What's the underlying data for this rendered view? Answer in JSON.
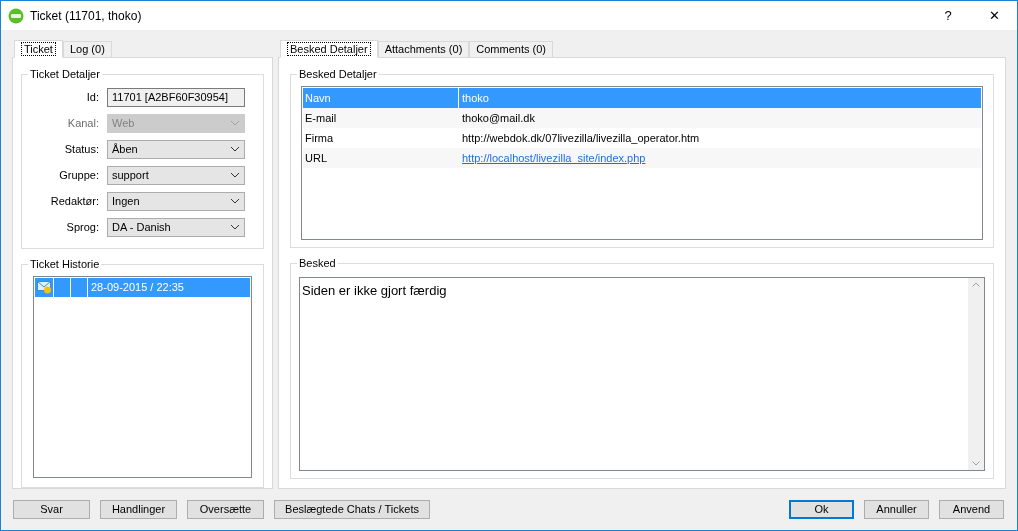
{
  "window": {
    "title": "Ticket (11701, thoko)",
    "controls": [
      "?",
      "✕"
    ]
  },
  "left_tabs": [
    {
      "label": "Ticket",
      "selected": true
    },
    {
      "label": "Log (0)",
      "selected": false
    }
  ],
  "ticket_details": {
    "title": "Ticket Detaljer",
    "fields": [
      {
        "label": "Id:",
        "kind": "text",
        "value": "11701 [A2BF60F30954]",
        "disabled": false
      },
      {
        "label": "Kanal:",
        "kind": "select",
        "value": "Web",
        "disabled": true
      },
      {
        "label": "Status:",
        "kind": "select",
        "value": "Åben",
        "disabled": false
      },
      {
        "label": "Gruppe:",
        "kind": "select",
        "value": "support",
        "disabled": false
      },
      {
        "label": "Redaktør:",
        "kind": "select",
        "value": "Ingen",
        "disabled": false
      },
      {
        "label": "Sprog:",
        "kind": "select",
        "value": "DA - Danish",
        "disabled": false
      }
    ]
  },
  "ticket_history": {
    "title": "Ticket Historie",
    "rows": [
      {
        "date": "28-09-2015 / 22:35",
        "selected": true
      }
    ]
  },
  "right_tabs": [
    {
      "label": "Besked Detaljer",
      "selected": true
    },
    {
      "label": "Attachments (0)",
      "selected": false
    },
    {
      "label": "Comments (0)",
      "selected": false
    }
  ],
  "message_details": {
    "title": "Besked Detaljer",
    "rows": [
      {
        "name": "Navn",
        "value": "thoko",
        "kind": "text",
        "selected": true
      },
      {
        "name": "E-mail",
        "value": "thoko@mail.dk",
        "kind": "text",
        "selected": false
      },
      {
        "name": "Firma",
        "value": "http://webdok.dk/07livezilla/livezilla_operator.htm",
        "kind": "text",
        "selected": false
      },
      {
        "name": "URL",
        "value": "http://localhost/livezilla_site/index.php",
        "kind": "link",
        "selected": false
      }
    ]
  },
  "message": {
    "title": "Besked",
    "value": "Siden er ikke gjort færdig"
  },
  "left_buttons": [
    {
      "label": "Svar",
      "default": false
    },
    {
      "label": "Handlinger",
      "default": false
    },
    {
      "label": "Oversætte",
      "default": false
    },
    {
      "label": "Beslægtede Chats / Tickets",
      "default": false
    }
  ],
  "right_buttons": [
    {
      "label": "Ok",
      "default": true
    },
    {
      "label": "Annuller",
      "default": false
    },
    {
      "label": "Anvend",
      "default": false
    }
  ]
}
